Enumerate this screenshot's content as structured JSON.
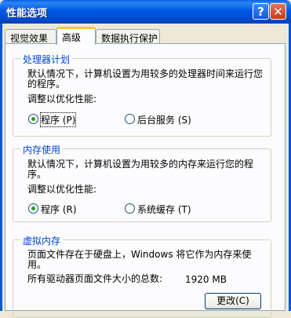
{
  "window": {
    "title": "性能选项",
    "help_glyph": "?",
    "close_glyph": "✕"
  },
  "tabs": [
    {
      "label": "视觉效果"
    },
    {
      "label": "高级",
      "active": true
    },
    {
      "label": "数据执行保护"
    }
  ],
  "processor": {
    "title": "处理器计划",
    "description": "默认情况下，计算机设置为用较多的处理器时间来运行您的程序。",
    "adjust_label": "调整以优化性能:",
    "options": [
      {
        "label": "程序 (P)",
        "selected": true
      },
      {
        "label": "后台服务 (S)",
        "selected": false
      }
    ]
  },
  "memory": {
    "title": "内存使用",
    "description": "默认情况下，计算机设置为用较多的内存来运行您的程序。",
    "adjust_label": "调整以优化性能:",
    "options": [
      {
        "label": "程序 (R)",
        "selected": true
      },
      {
        "label": "系统缓存 (T)",
        "selected": false
      }
    ]
  },
  "virtual_memory": {
    "title": "虚拟内存",
    "description": "页面文件存在于硬盘上，Windows 将它作为内存来使用。",
    "total_label": "所有驱动器页面文件大小的总数:",
    "total_value": "1920 MB",
    "change_button": "更改(C)"
  },
  "colors": {
    "accent": "#0046D5",
    "titlebar": "#0058E3",
    "face": "#ECE9D8"
  }
}
